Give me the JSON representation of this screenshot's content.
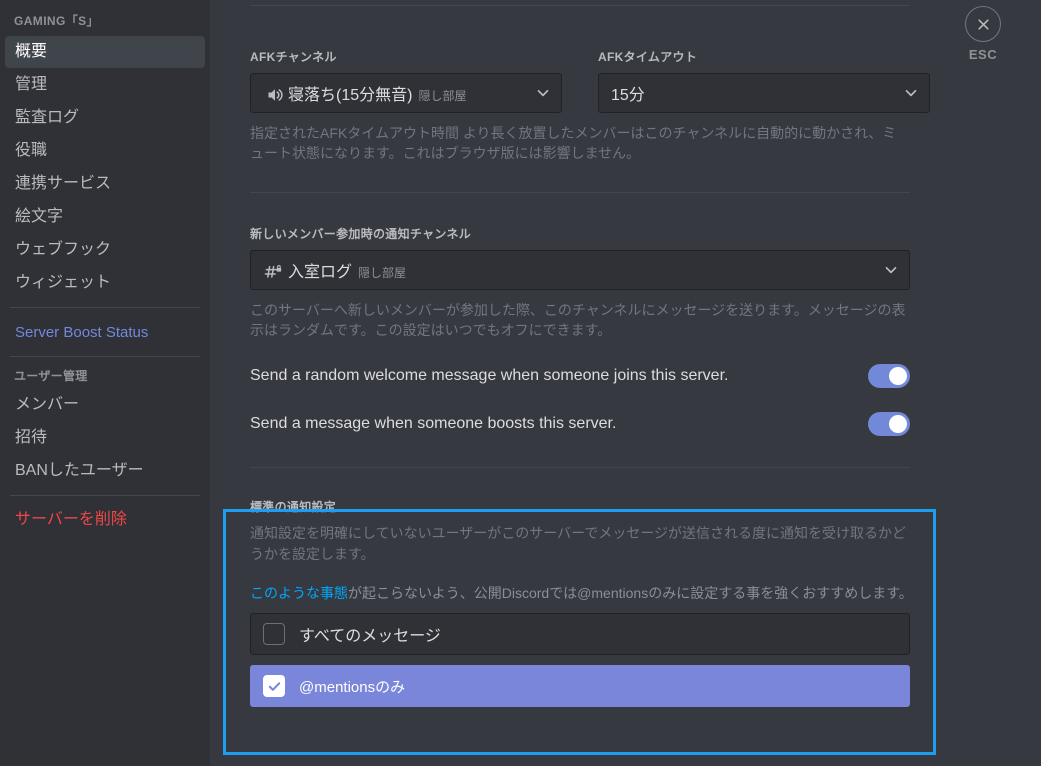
{
  "sidebar": {
    "server_name": "GAMING「S」",
    "items": [
      {
        "label": "概要",
        "active": true
      },
      {
        "label": "管理",
        "active": false
      },
      {
        "label": "監査ログ",
        "active": false
      },
      {
        "label": "役職",
        "active": false
      },
      {
        "label": "連携サービス",
        "active": false
      },
      {
        "label": "絵文字",
        "active": false
      },
      {
        "label": "ウェブフック",
        "active": false
      },
      {
        "label": "ウィジェット",
        "active": false
      }
    ],
    "boost_link": "Server Boost Status",
    "user_section_header": "ユーザー管理",
    "user_items": [
      {
        "label": "メンバー"
      },
      {
        "label": "招待"
      },
      {
        "label": "BANしたユーザー"
      }
    ],
    "delete_server": "サーバーを削除"
  },
  "close": {
    "label": "ESC",
    "icon": "close-icon"
  },
  "main": {
    "afk_channel": {
      "label": "AFKチャンネル",
      "value": "寝落ち(15分無音)",
      "value_suffix": "隠し部屋",
      "icon": "voice-channel-icon"
    },
    "afk_timeout": {
      "label": "AFKタイムアウト",
      "value": "15分"
    },
    "afk_helper": "指定されたAFKタイムアウト時間 より長く放置したメンバーはこのチャンネルに自動的に動かされ、ミュート状態になります。これはブラウザ版には影響しません。",
    "welcome_channel": {
      "label": "新しいメンバー参加時の通知チャンネル",
      "value": "入室ログ",
      "value_suffix": "隠し部屋",
      "icon": "locked-text-channel-icon"
    },
    "welcome_helper": "このサーバーへ新しいメンバーが参加した際、このチャンネルにメッセージを送ります。メッセージの表示はランダムです。この設定はいつでもオフにできます。",
    "toggles": [
      {
        "label": "Send a random welcome message when someone joins this server.",
        "on": true
      },
      {
        "label": "Send a message when someone boosts this server.",
        "on": true
      }
    ],
    "notifications": {
      "title": "標準の通知設定",
      "description": "通知設定を明確にしていないユーザーがこのサーバーでメッセージが送信される度に通知を受け取るかどうかを設定します。",
      "note_link": "このような事態",
      "note_rest": "が起こらないよう、公開Discordでは@mentionsのみに設定する事を強くおすすめします。",
      "options": [
        {
          "label": "すべてのメッセージ",
          "selected": false
        },
        {
          "label": "@mentionsのみ",
          "selected": true
        }
      ]
    }
  },
  "colors": {
    "accent_blurple": "#7289da",
    "highlight_border": "#1e9ef0",
    "link_blue": "#00a8fc",
    "danger_red": "#f04747",
    "sidebar_bg": "#2f3136",
    "main_bg": "#36393f",
    "selected_option_bg": "#7a86da"
  }
}
